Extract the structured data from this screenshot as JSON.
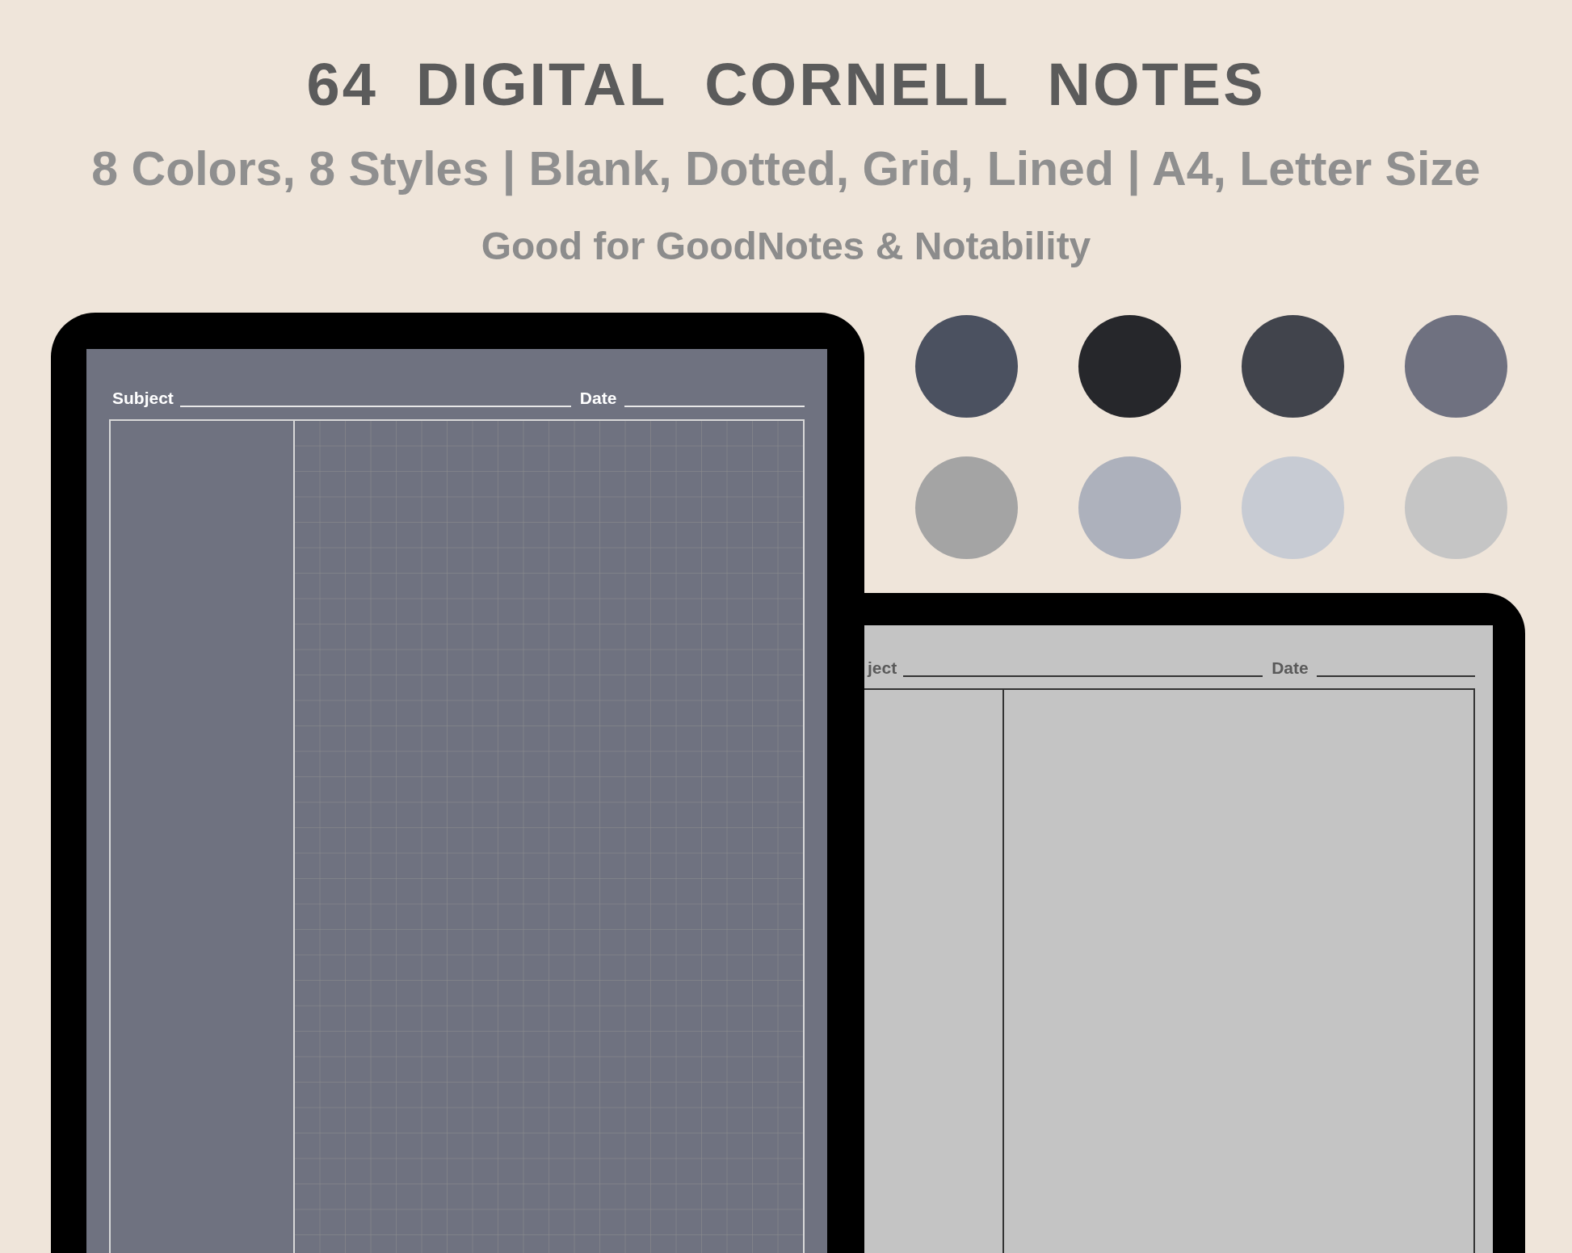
{
  "header": {
    "title": "64  DIGITAL  CORNELL  NOTES",
    "subtitle": "8 Colors, 8 Styles | Blank, Dotted, Grid, Lined | A4, Letter Size",
    "note": "Good for GoodNotes & Notability"
  },
  "swatches": [
    {
      "color": "#4b5160"
    },
    {
      "color": "#26272b"
    },
    {
      "color": "#41444c"
    },
    {
      "color": "#6f7180"
    },
    {
      "color": "#a4a4a4"
    },
    {
      "color": "#adb1bc"
    },
    {
      "color": "#c7cbd3"
    },
    {
      "color": "#c5c5c5"
    }
  ],
  "tablets": [
    {
      "kind": "grid",
      "color": "#6f7280",
      "subject_label": "Subject",
      "date_label": "Date"
    },
    {
      "kind": "blank",
      "color": "#c4c4c4",
      "subject_label": "ject",
      "date_label": "Date"
    }
  ]
}
